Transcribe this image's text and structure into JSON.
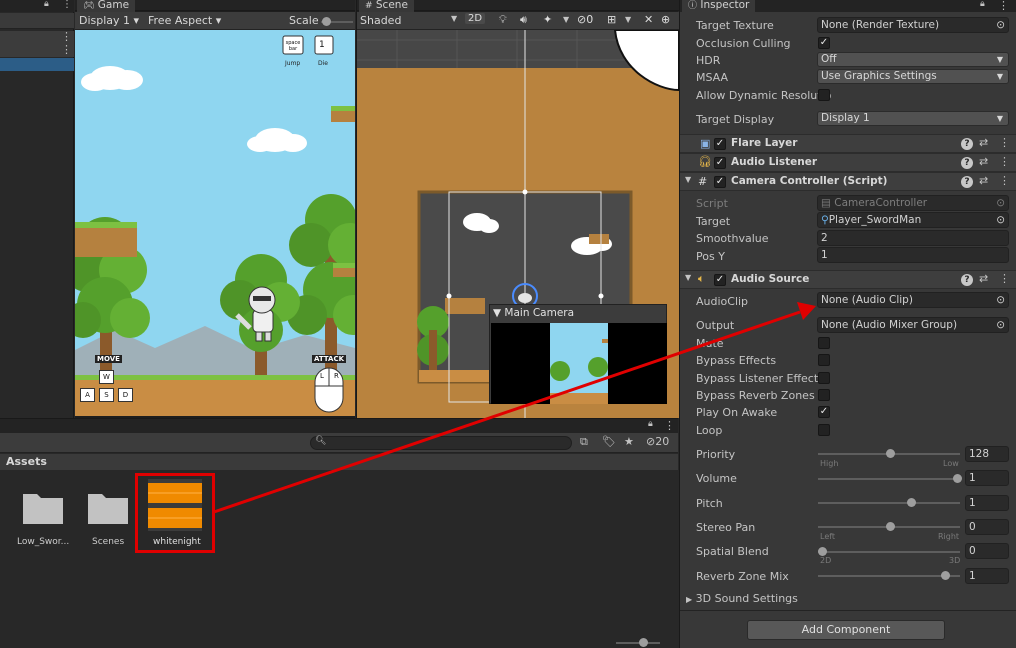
{
  "hierarchy": {
    "rows": 3
  },
  "game": {
    "tab": "Game",
    "display": "Display 1",
    "aspect": "Free Aspect",
    "scale_label": "Scale",
    "hud": {
      "jump_key": "space bar",
      "jump_label": "Jump",
      "die_key": "1",
      "die_label": "Die",
      "move_label": "MOVE",
      "keys": [
        "W",
        "A",
        "S",
        "D"
      ],
      "attack_label": "ATTACK",
      "mouse_buttons": [
        "L",
        "R"
      ]
    }
  },
  "scene": {
    "tab": "Scene",
    "shading": "Shaded",
    "mode_2d": "2D",
    "hidden_count": "0",
    "camera_preview_title": "Main Camera"
  },
  "project": {
    "search_placeholder": "",
    "count": "20",
    "assets_title": "Assets",
    "items": [
      {
        "name": "Low_Swor...",
        "type": "folder"
      },
      {
        "name": "Scenes",
        "type": "folder"
      },
      {
        "name": "whitenight",
        "type": "audio",
        "selected": true
      }
    ]
  },
  "inspector": {
    "tab": "Inspector",
    "camera_props": [
      {
        "label": "Target Texture",
        "value": "None (Render Texture)",
        "kind": "object"
      },
      {
        "label": "Occlusion Culling",
        "checked": true,
        "kind": "check"
      },
      {
        "label": "HDR",
        "value": "Off",
        "kind": "dropdown"
      },
      {
        "label": "MSAA",
        "value": "Use Graphics Settings",
        "kind": "dropdown"
      },
      {
        "label": "Allow Dynamic Resolutio",
        "checked": false,
        "kind": "check"
      },
      {
        "label": "Target Display",
        "value": "Display 1",
        "kind": "dropdown"
      }
    ],
    "flare_layer": "Flare Layer",
    "audio_listener": "Audio Listener",
    "camera_controller": {
      "title": "Camera Controller (Script)",
      "script_label": "Script",
      "script_value": "CameraController",
      "target_label": "Target",
      "target_value": "Player_SwordMan",
      "smooth_label": "Smoothvalue",
      "smooth_value": "2",
      "posy_label": "Pos Y",
      "posy_value": "1"
    },
    "audio_source": {
      "title": "Audio Source",
      "clip_label": "AudioClip",
      "clip_value": "None (Audio Clip)",
      "output_label": "Output",
      "output_value": "None (Audio Mixer Group)",
      "checks": [
        {
          "label": "Mute",
          "checked": false
        },
        {
          "label": "Bypass Effects",
          "checked": false
        },
        {
          "label": "Bypass Listener Effects",
          "checked": false
        },
        {
          "label": "Bypass Reverb Zones",
          "checked": false
        },
        {
          "label": "Play On Awake",
          "checked": true
        },
        {
          "label": "Loop",
          "checked": false
        }
      ],
      "priority": {
        "label": "Priority",
        "value": "128",
        "level": 0.5,
        "left": "High",
        "right": "Low"
      },
      "volume": {
        "label": "Volume",
        "value": "1",
        "level": 1.0
      },
      "pitch": {
        "label": "Pitch",
        "value": "1",
        "level": 0.66
      },
      "stereo_pan": {
        "label": "Stereo Pan",
        "value": "0",
        "level": 0.5,
        "left": "Left",
        "right": "Right"
      },
      "spatial_blend": {
        "label": "Spatial Blend",
        "value": "0",
        "level": 0.0,
        "left": "2D",
        "right": "3D"
      },
      "reverb_mix": {
        "label": "Reverb Zone Mix",
        "value": "1",
        "level": 0.91
      },
      "sound_settings": "3D Sound Settings"
    },
    "add_component": "Add Component"
  },
  "colors": {
    "highlight": "#e00000",
    "selection": "#2c5d87",
    "audio_waveform": "#f08a00"
  }
}
